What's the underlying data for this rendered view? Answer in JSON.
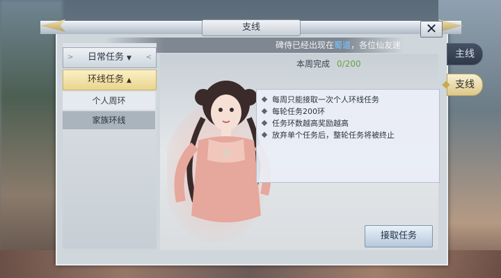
{
  "window": {
    "title": "支线",
    "close_glyph": "✕"
  },
  "marquee": {
    "prefix": "碑侍已经出现在",
    "highlight": "蜀道",
    "suffix": "，各位仙友速"
  },
  "menu": {
    "categories": [
      {
        "label": "日常任务",
        "arrow": "▼",
        "left_deco": ">",
        "right_deco": "<"
      },
      {
        "label": "环线任务",
        "arrow": "▲"
      }
    ],
    "subitems": [
      {
        "label": "个人周环"
      },
      {
        "label": "家族环线"
      }
    ]
  },
  "weekly": {
    "label": "本周完成",
    "count": "0/200"
  },
  "info": {
    "lines": [
      "每周只能接取一次个人环线任务",
      "每轮任务200环",
      "任务环数越高奖励越高",
      "放弃单个任务后，整轮任务将被终止"
    ]
  },
  "accept_button": {
    "label": "接取任务"
  },
  "side_tabs": [
    {
      "label": "主线"
    },
    {
      "label": "支线"
    }
  ],
  "colors": {
    "highlight_blue": "#79c8ff",
    "count_green": "#6aa046",
    "selected_gold": "#e9d58e"
  }
}
